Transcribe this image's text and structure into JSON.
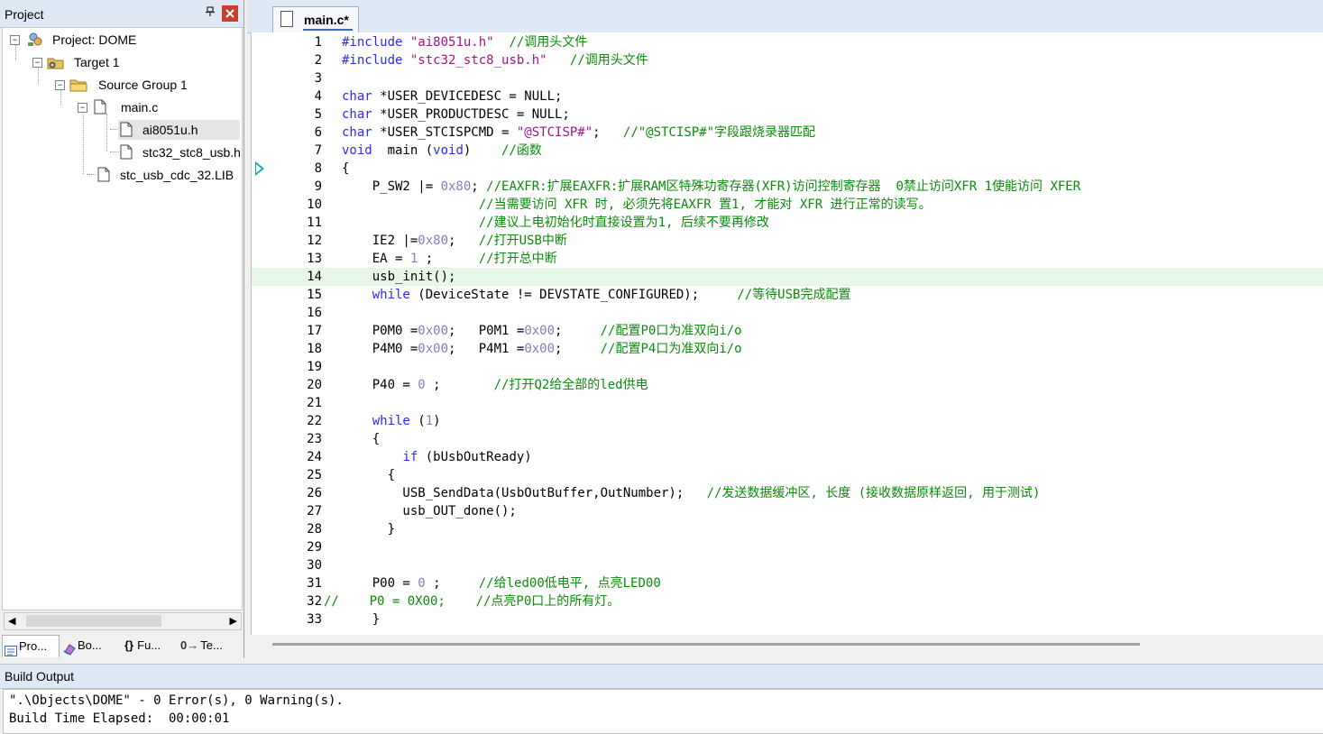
{
  "project_pane": {
    "title": "Project",
    "pin_glyph": "—",
    "close_glyph": "x",
    "tree": [
      {
        "label": "Project: DOME",
        "icon": "project-icon"
      },
      {
        "label": "Target 1",
        "icon": "target-icon"
      },
      {
        "label": "Source Group 1",
        "icon": "folder-icon"
      },
      {
        "label": "main.c",
        "icon": "file-icon"
      },
      {
        "label": "ai8051u.h",
        "icon": "file-icon",
        "selected": true
      },
      {
        "label": "stc32_stc8_usb.h",
        "icon": "file-icon"
      },
      {
        "label": "stc_usb_cdc_32.LIB",
        "icon": "file-icon"
      }
    ],
    "tabs": [
      {
        "label": "Pro...",
        "icon": "project-tab-icon"
      },
      {
        "label": "Bo...",
        "icon": "books-tab-icon"
      },
      {
        "label": "Fu...",
        "icon": "functions-tab-icon",
        "glyph": "{}"
      },
      {
        "label": "Te...",
        "icon": "templates-tab-icon",
        "glyph": "0→"
      }
    ]
  },
  "editor": {
    "tab_label": "main.c*",
    "colors": {
      "keyword": "#2a2aff",
      "string": "#a0158a",
      "number": "#8080c0",
      "comment": "#0b8a0b",
      "current_line": "#e8f8e8"
    },
    "current_line": 14,
    "lines": [
      {
        "n": "1",
        "parts": [
          [
            "kw",
            "#include"
          ],
          [
            "t",
            " "
          ],
          [
            "str",
            "\"ai8051u.h\""
          ],
          [
            "t",
            "  "
          ],
          [
            "cmt",
            "//调用头文件"
          ]
        ]
      },
      {
        "n": "2",
        "parts": [
          [
            "kw",
            "#include"
          ],
          [
            "t",
            " "
          ],
          [
            "str",
            "\"stc32_stc8_usb.h\""
          ],
          [
            "t",
            "   "
          ],
          [
            "cmt",
            "//调用头文件"
          ]
        ]
      },
      {
        "n": "3",
        "parts": []
      },
      {
        "n": "4",
        "parts": [
          [
            "kw",
            "char"
          ],
          [
            "t",
            " *USER_DEVICEDESC = NULL;"
          ]
        ]
      },
      {
        "n": "5",
        "parts": [
          [
            "kw",
            "char"
          ],
          [
            "t",
            " *USER_PRODUCTDESC = NULL;"
          ]
        ]
      },
      {
        "n": "6",
        "parts": [
          [
            "kw",
            "char"
          ],
          [
            "t",
            " *USER_STCISPCMD = "
          ],
          [
            "str",
            "\"@STCISP#\""
          ],
          [
            "t",
            ";   "
          ],
          [
            "cmt",
            "//\"@STCISP#\"字段跟烧录器匹配"
          ]
        ]
      },
      {
        "n": "7",
        "parts": [
          [
            "kw",
            "void"
          ],
          [
            "t",
            "  main ("
          ],
          [
            "kw",
            "void"
          ],
          [
            "t",
            ")    "
          ],
          [
            "cmt",
            "//函数"
          ]
        ]
      },
      {
        "n": "8",
        "parts": [
          [
            "t",
            "{"
          ]
        ]
      },
      {
        "n": "9",
        "parts": [
          [
            "t",
            "    P_SW2 |= "
          ],
          [
            "num",
            "0x80"
          ],
          [
            "t",
            "; "
          ],
          [
            "cmt",
            "//EAXFR:扩展EAXFR:扩展RAM区特殊功寄存器(XFR)访问控制寄存器  0禁止访问XFR 1使能访问 XFER"
          ]
        ]
      },
      {
        "n": "10",
        "parts": [
          [
            "t",
            "                  "
          ],
          [
            "cmt",
            "//当需要访问 XFR 时, 必须先将EAXFR 置1, 才能对 XFR 进行正常的读写。"
          ]
        ]
      },
      {
        "n": "11",
        "parts": [
          [
            "t",
            "                  "
          ],
          [
            "cmt",
            "//建议上电初始化时直接设置为1, 后续不要再修改"
          ]
        ]
      },
      {
        "n": "12",
        "parts": [
          [
            "t",
            "    IE2 |="
          ],
          [
            "num",
            "0x80"
          ],
          [
            "t",
            ";   "
          ],
          [
            "cmt",
            "//打开USB中断"
          ]
        ]
      },
      {
        "n": "13",
        "parts": [
          [
            "t",
            "    EA = "
          ],
          [
            "num",
            "1"
          ],
          [
            "t",
            " ;      "
          ],
          [
            "cmt",
            "//打开总中断"
          ]
        ]
      },
      {
        "n": "14",
        "parts": [
          [
            "t",
            "    usb_init();"
          ]
        ]
      },
      {
        "n": "15",
        "parts": [
          [
            "t",
            "    "
          ],
          [
            "kw",
            "while"
          ],
          [
            "t",
            " (DeviceState != DEVSTATE_CONFIGURED);     "
          ],
          [
            "cmt",
            "//等待USB完成配置"
          ]
        ]
      },
      {
        "n": "16",
        "parts": []
      },
      {
        "n": "17",
        "parts": [
          [
            "t",
            "    P0M0 ="
          ],
          [
            "num",
            "0x00"
          ],
          [
            "t",
            ";   P0M1 ="
          ],
          [
            "num",
            "0x00"
          ],
          [
            "t",
            ";     "
          ],
          [
            "cmt",
            "//配置P0口为准双向i/o"
          ]
        ]
      },
      {
        "n": "18",
        "parts": [
          [
            "t",
            "    P4M0 ="
          ],
          [
            "num",
            "0x00"
          ],
          [
            "t",
            ";   P4M1 ="
          ],
          [
            "num",
            "0x00"
          ],
          [
            "t",
            ";     "
          ],
          [
            "cmt",
            "//配置P4口为准双向i/o"
          ]
        ]
      },
      {
        "n": "19",
        "parts": []
      },
      {
        "n": "20",
        "parts": [
          [
            "t",
            "    P40 = "
          ],
          [
            "num",
            "0"
          ],
          [
            "t",
            " ;       "
          ],
          [
            "cmt",
            "//打开Q2给全部的led供电"
          ]
        ]
      },
      {
        "n": "21",
        "parts": []
      },
      {
        "n": "22",
        "parts": [
          [
            "t",
            "    "
          ],
          [
            "kw",
            "while"
          ],
          [
            "t",
            " ("
          ],
          [
            "num",
            "1"
          ],
          [
            "t",
            ")"
          ]
        ]
      },
      {
        "n": "23",
        "parts": [
          [
            "t",
            "    {"
          ]
        ]
      },
      {
        "n": "24",
        "parts": [
          [
            "t",
            "        "
          ],
          [
            "kw",
            "if"
          ],
          [
            "t",
            " (bUsbOutReady)"
          ]
        ]
      },
      {
        "n": "25",
        "parts": [
          [
            "t",
            "      {"
          ]
        ]
      },
      {
        "n": "26",
        "parts": [
          [
            "t",
            "        USB_SendData(UsbOutBuffer,OutNumber);   "
          ],
          [
            "cmt",
            "//发送数据缓冲区, 长度 (接收数据原样返回, 用于测试)"
          ]
        ]
      },
      {
        "n": "27",
        "parts": [
          [
            "t",
            "        usb_OUT_done();"
          ]
        ]
      },
      {
        "n": "28",
        "parts": [
          [
            "t",
            "      }"
          ]
        ]
      },
      {
        "n": "29",
        "parts": []
      },
      {
        "n": "30",
        "parts": []
      },
      {
        "n": "31",
        "parts": [
          [
            "t",
            "    P00 = "
          ],
          [
            "num",
            "0"
          ],
          [
            "t",
            " ;     "
          ],
          [
            "cmt",
            "//给led00低电平, 点亮LED00"
          ]
        ]
      },
      {
        "n": "32",
        "left": true,
        "parts": [
          [
            "cmt",
            "//    P0 = 0X00;    //点亮P0口上的所有灯。"
          ]
        ]
      },
      {
        "n": "33",
        "parts": [
          [
            "t",
            "    }"
          ]
        ]
      }
    ]
  },
  "build_output": {
    "title": "Build Output",
    "lines": [
      "\".\\Objects\\DOME\" - 0 Error(s), 0 Warning(s).",
      "Build Time Elapsed:  00:00:01"
    ]
  }
}
